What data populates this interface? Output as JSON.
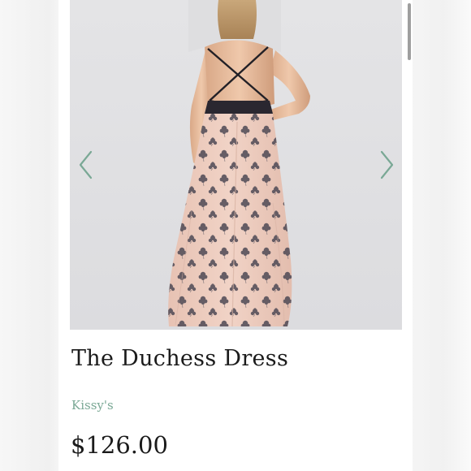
{
  "product": {
    "title": "The Duchess Dress",
    "brand": "Kissy's",
    "price": "$126.00"
  },
  "carousel": {
    "prev_icon": "chevron-left-icon",
    "next_icon": "chevron-right-icon"
  },
  "colors": {
    "accent": "#7aa895",
    "photo_background": "#e1e1e3",
    "dress_base": "#ecc9bb",
    "dress_pattern": "#4a4550",
    "text": "#1b1b1b"
  }
}
